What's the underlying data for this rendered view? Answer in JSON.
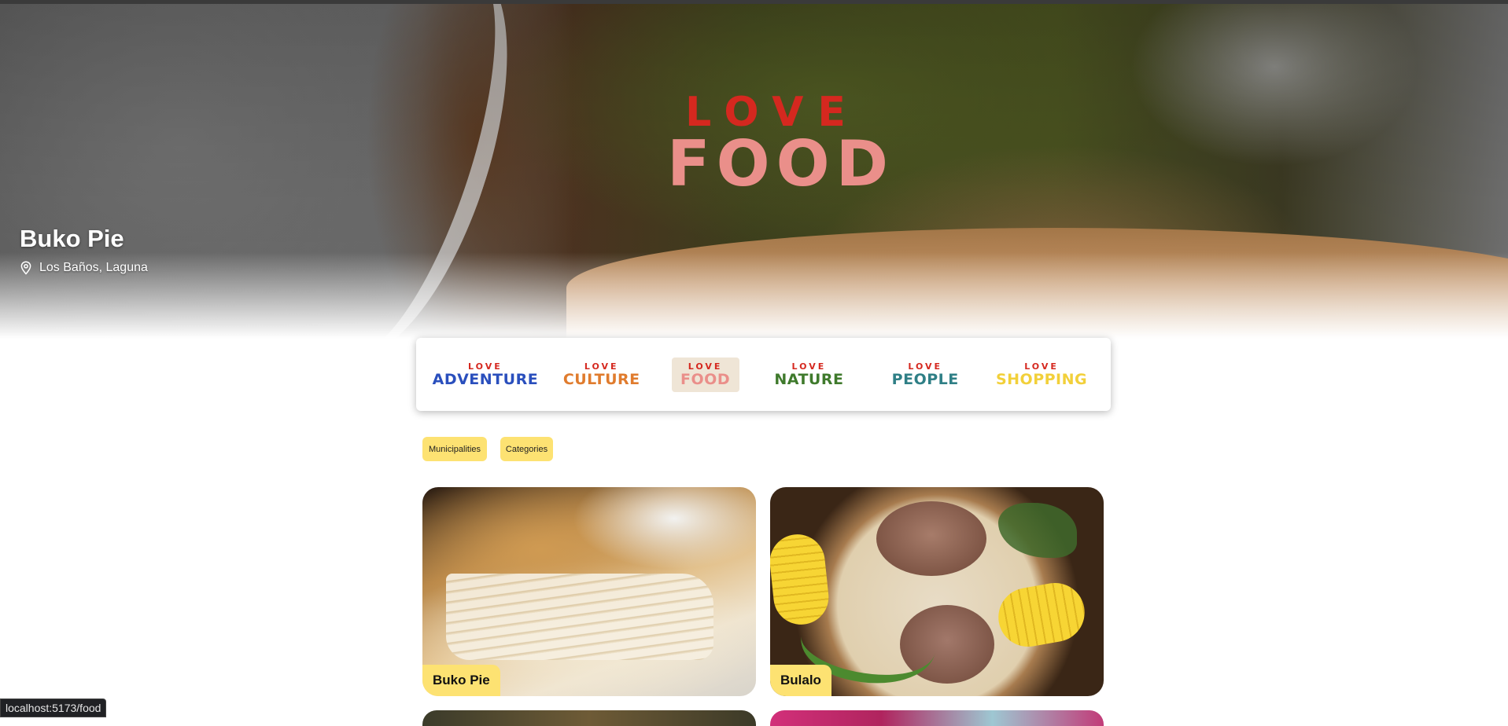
{
  "hero": {
    "title": "Buko Pie",
    "location": "Los Baños, Laguna",
    "location_icon": "map-pin-icon",
    "logo": {
      "top_word": "LOVE",
      "main_word": "FOOD",
      "top_color": "#d5281f",
      "main_color": "#ea8f8a"
    }
  },
  "categories": [
    {
      "top": "LOVE",
      "word": "ADVENTURE",
      "color": "#2a4fbd",
      "active": false
    },
    {
      "top": "LOVE",
      "word": "CULTURE",
      "color": "#e07c2e",
      "active": false
    },
    {
      "top": "LOVE",
      "word": "FOOD",
      "color": "#ea8f8a",
      "active": true
    },
    {
      "top": "LOVE",
      "word": "NATURE",
      "color": "#3f7a2c",
      "active": false
    },
    {
      "top": "LOVE",
      "word": "PEOPLE",
      "color": "#2f7f86",
      "active": false
    },
    {
      "top": "LOVE",
      "word": "SHOPPING",
      "color": "#f2d03a",
      "active": false
    }
  ],
  "filters": {
    "municipalities_label": "Municipalities",
    "categories_label": "Categories",
    "chip_color": "#fde272"
  },
  "cards": [
    {
      "name": "Buko Pie"
    },
    {
      "name": "Bulalo"
    }
  ],
  "status_bar": {
    "url": "localhost:5173/food"
  }
}
